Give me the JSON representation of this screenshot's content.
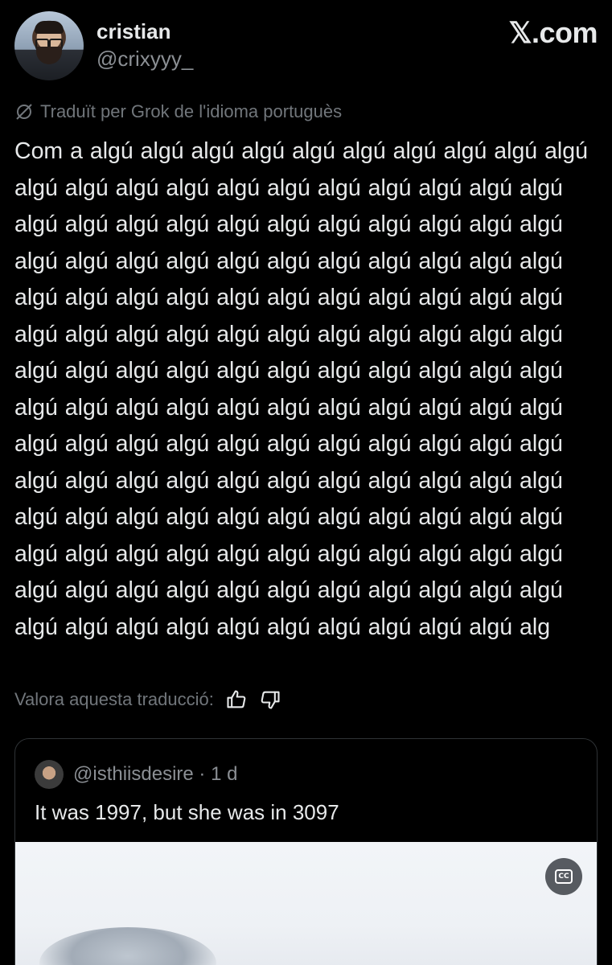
{
  "author": {
    "name": "cristian",
    "handle": "@crixyyy_"
  },
  "brand": {
    "label": "𝕏.com"
  },
  "translation_notice": "Traduït per Grok de l'idioma portuguès",
  "tweet": {
    "text": "Com a algú algú algú algú algú algú algú algú algú algú algú algú algú algú algú algú algú algú algú algú algú algú algú algú algú algú algú algú algú algú algú algú algú algú algú algú algú algú algú algú algú algú algú algú algú algú algú algú algú algú algú algú algú algú algú algú algú algú algú algú algú algú algú algú algú algú algú algú algú algú algú algú algú algú algú algú algú algú algú algú algú algú algú algú algú algú algú algú algú algú algú algú algú algú algú algú algú algú algú algú algú algú algú algú algú algú algú algú algú algú algú algú algú algú algú algú algú algú algú algú algú algú algú algú algú algú algú algú algú algú algú algú algú algú algú algú algú algú algú algú algú algú algú algú algú algú algú algú algú algú algú algú alg"
  },
  "rating": {
    "label": "Valora aquesta traducció:"
  },
  "quoted": {
    "handle_time": "@isthiisdesire · 1 d",
    "text": "It was 1997, but she was in 3097",
    "cc_label": "CC"
  },
  "icons": {
    "translate": "slashed-circle-icon",
    "thumbs_up": "thumbs-up-icon",
    "thumbs_down": "thumbs-down-icon",
    "captions": "closed-captions-icon"
  },
  "colors": {
    "background": "#000000",
    "text": "#e7e9ea",
    "muted": "#71767b",
    "border": "#2f3336"
  }
}
